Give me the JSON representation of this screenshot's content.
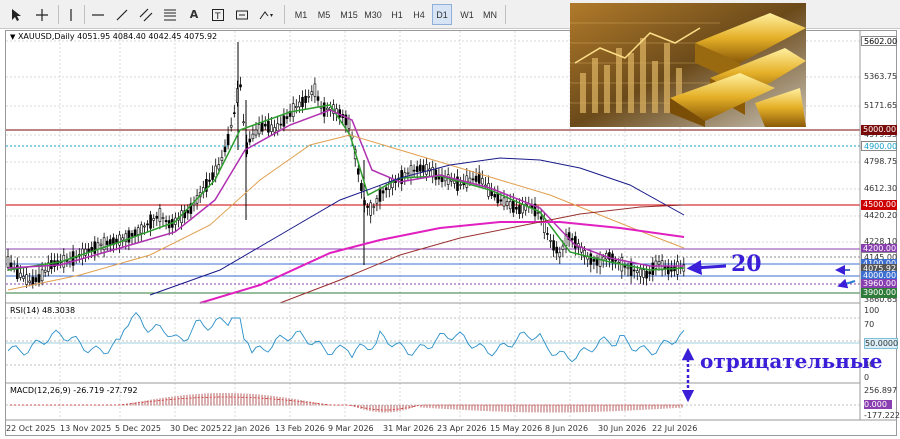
{
  "toolbar": {
    "timeframes": [
      "M1",
      "M5",
      "M15",
      "M30",
      "H1",
      "H4",
      "D1",
      "W1",
      "MN"
    ],
    "active_timeframe": "D1"
  },
  "chart": {
    "symbol_line": "XAUUSD,Daily  4051.95 4084.40 4042.45 4075.92",
    "price_axis": [
      "5602.00",
      "5363.75",
      "5171.65",
      "4979.55",
      "4798.75",
      "4612.30",
      "4420.20",
      "4228.10",
      "3860.65"
    ],
    "highlighted_levels": [
      {
        "label": "5602.00",
        "color": "#ffffff",
        "text_color": "#000000"
      },
      {
        "label": "5000.00",
        "color": "#7a0a0a",
        "text_color": "#ffffff"
      },
      {
        "label": "4900.00",
        "color": "#ffffff",
        "text_color": "#17a2c9"
      },
      {
        "label": "4500.00",
        "color": "#cc0000",
        "text_color": "#ffffff"
      },
      {
        "label": "4200.00",
        "color": "#8a3fb0",
        "text_color": "#ffffff"
      },
      {
        "label": "4145.00",
        "color": "#ffffff",
        "text_color": "#333333"
      },
      {
        "label": "4100.00",
        "color": "#3d6fd1",
        "text_color": "#ffffff"
      },
      {
        "label": "4075.92",
        "color": "#555555",
        "text_color": "#ffffff"
      },
      {
        "label": "4000.00",
        "color": "#3d6fd1",
        "text_color": "#ffffff"
      },
      {
        "label": "3960.00",
        "color": "#8a3fb0",
        "text_color": "#ffffff"
      },
      {
        "label": "3900.00",
        "color": "#2f7c3a",
        "text_color": "#ffffff"
      }
    ],
    "dates": [
      "22 Oct 2025",
      "13 Nov 2025",
      "5 Dec 2025",
      "30 Dec 2025",
      "22 Jan 2026",
      "13 Feb 2026",
      "9 Mar 2026",
      "31 Mar 2026",
      "23 Apr 2026",
      "15 May 2026",
      "8 Jun 2026",
      "30 Jun 2026",
      "22 Jul 2026"
    ]
  },
  "rsi": {
    "title": "RSI(14) 48.3038",
    "axis": [
      "100",
      "70",
      "50.0000",
      "30",
      "0"
    ],
    "value": 48.3
  },
  "macd": {
    "title": "MACD(12,26,9) -26.719 -27.792",
    "axis": [
      "256.897",
      "0.000",
      "-177.222"
    ]
  },
  "annotations": {
    "number": "20",
    "word": "отрицательные"
  },
  "colors": {
    "accent_blue": "#3b1fd8",
    "candles": "#000000",
    "ma_green": "#2e9d2e",
    "ma_violet": "#b02fb0",
    "ma_orange": "#e0a050",
    "ma_navy": "#1a1a8a",
    "ma_magenta": "#e020c0",
    "ma_brown": "#9a3030"
  }
}
